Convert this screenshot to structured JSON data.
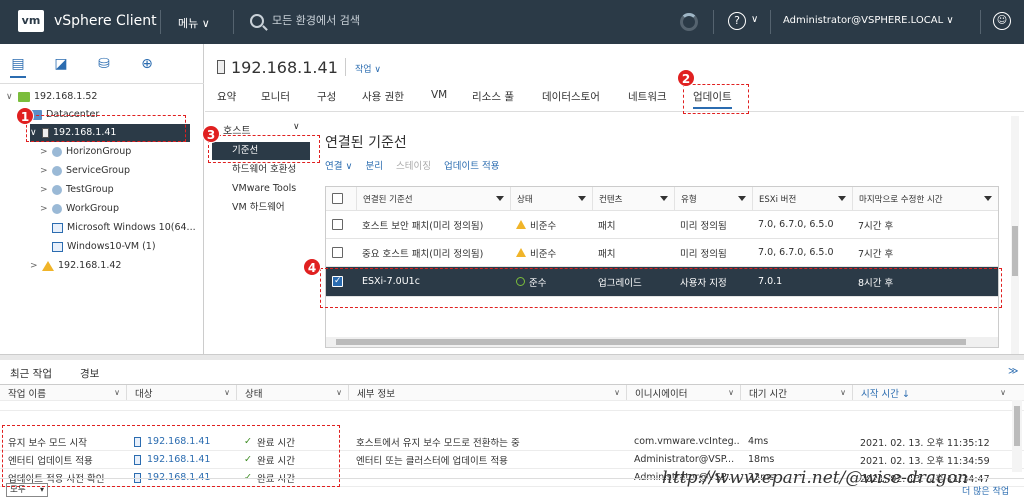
{
  "app": {
    "logo": "vm",
    "title": "vSphere Client",
    "menu": "메뉴 ∨",
    "search_placeholder": "모든 환경에서 검색",
    "help": "?",
    "user": "Administrator@VSPHERE.LOCAL ∨"
  },
  "tree": {
    "items": [
      {
        "label": "192.168.1.52",
        "twisty": "∨"
      },
      {
        "label": "Datacenter",
        "twisty": "∨"
      },
      {
        "label": "192.168.1.41",
        "twisty": "∨"
      },
      {
        "label": "HorizonGroup",
        "twisty": ">"
      },
      {
        "label": "ServiceGroup",
        "twisty": ">"
      },
      {
        "label": "TestGroup",
        "twisty": ">"
      },
      {
        "label": "WorkGroup",
        "twisty": ">"
      },
      {
        "label": "Microsoft Windows 10(64...",
        "twisty": ""
      },
      {
        "label": "Windows10-VM (1)",
        "twisty": ""
      },
      {
        "label": "192.168.1.42",
        "twisty": ">"
      }
    ]
  },
  "object": {
    "title": "192.168.1.41",
    "actions": "작업 ∨"
  },
  "tabs": [
    "요약",
    "모니터",
    "구성",
    "사용 권한",
    "VM",
    "리소스 풀",
    "데이터스토어",
    "네트워크",
    "업데이트"
  ],
  "sidenav": {
    "header": "호스트",
    "items": [
      "기준선",
      "하드웨어 호환성",
      "VMware Tools",
      "VM 하드웨어"
    ]
  },
  "baselines": {
    "title": "연결된 기준선",
    "actions": [
      "연결 ∨",
      "분리",
      "스테이징",
      "업데이트 적용"
    ],
    "columns": [
      "연결된 기준선",
      "상태",
      "컨텐츠",
      "유형",
      "ESXi 버전",
      "마지막으로 수정한 시간"
    ],
    "rows": [
      {
        "name": "호스트 보안 패치(미리 정의됨)",
        "status": "비준수",
        "content": "패치",
        "type": "미리 정의됨",
        "esxi": "7.0, 6.7.0, 6.5.0",
        "modified": "7시간 후"
      },
      {
        "name": "중요 호스트 패치(미리 정의됨)",
        "status": "비준수",
        "content": "패치",
        "type": "미리 정의됨",
        "esxi": "7.0, 6.7.0, 6.5.0",
        "modified": "7시간 후"
      },
      {
        "name": "ESXi-7.0U1c",
        "status": "준수",
        "content": "업그레이드",
        "type": "사용자 지정",
        "esxi": "7.0.1",
        "modified": "8시간 후"
      }
    ]
  },
  "callouts": [
    "1",
    "2",
    "3",
    "4"
  ],
  "recent": {
    "tabs": [
      "최근 작업",
      "경보"
    ],
    "collapse": "≫",
    "columns": [
      "작업 이름",
      "대상",
      "상태",
      "세부 정보",
      "이니시에이터",
      "대기 시간",
      "시작 시간 ↓"
    ],
    "rows": [
      {
        "task": "유지 보수 모드 시작",
        "target": "192.168.1.41",
        "status": "완료 시간",
        "details": "호스트에서 유지 보수 모드로 전환하는 중",
        "initiator": "com.vmware.vcInteg...",
        "queued": "4ms",
        "start": "2021. 02. 13. 오후 11:35:12"
      },
      {
        "task": "엔터티 업데이트 적용",
        "target": "192.168.1.41",
        "status": "완료 시간",
        "details": "엔터티 또는 클러스터에 업데이트 적용",
        "initiator": "Administrator@VSP...",
        "queued": "18ms",
        "start": "2021. 02. 13. 오후 11:34:59"
      },
      {
        "task": "업데이트 적용 사전 확인",
        "target": "192.168.1.41",
        "status": "완료 시간",
        "details": "",
        "initiator": "Administrator@VSP...",
        "queued": "23ms",
        "start": "2021. 02. 13. 오후 11:34:47"
      }
    ],
    "filter": "모두",
    "more": "더 많은 작업",
    "watermark": "http://www.epari.net/@wise-dragon"
  },
  "colors": {
    "topbar": "#2b3a47",
    "accent": "#2b6cb0",
    "callout": "#e02020",
    "ok": "#3a8a1f",
    "warn": "#f0b429"
  }
}
